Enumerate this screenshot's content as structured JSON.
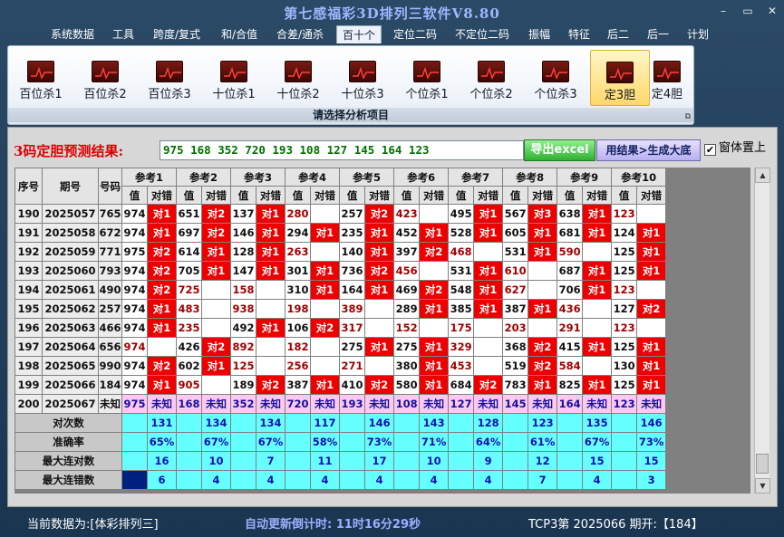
{
  "window": {
    "title": "第七感福彩3D排列三软件V8.80",
    "minimize": "–",
    "maximize": "▭",
    "close": "✕"
  },
  "menu": [
    "系统数据",
    "工具",
    "跨度/复式",
    "和/合值",
    "合差/通杀",
    "百十个",
    "定位二码",
    "不定位二码",
    "振幅",
    "特征",
    "后二",
    "后一",
    "计划"
  ],
  "menu_active": "百十个",
  "ribbon": {
    "buttons": [
      "百位杀1",
      "百位杀2",
      "百位杀3",
      "十位杀1",
      "十位杀2",
      "十位杀3",
      "个位杀1",
      "个位杀2",
      "个位杀3",
      "定3胆",
      "定4胆"
    ],
    "active": "定3胆",
    "caption": "请选择分析项目"
  },
  "prediction": {
    "label": "3码定胆预测结果:",
    "value": "975 168 352 720 193 108 127 145 164 123",
    "excel_button": "导出excel",
    "generate_button": "用结果>生成大底",
    "stay_on_top_label": "窗体置上",
    "stay_on_top_checked": true
  },
  "table": {
    "headers": {
      "index": "序号",
      "period": "期号",
      "number": "号码",
      "value": "值",
      "hit": "对错"
    },
    "refs": [
      "参考1",
      "参考2",
      "参考3",
      "参考4",
      "参考5",
      "参考6",
      "参考7",
      "参考8",
      "参考9",
      "参考10"
    ],
    "rows": [
      {
        "idx": "190",
        "period": "2025057",
        "num": "765",
        "cells": [
          [
            "974",
            "对1"
          ],
          [
            "651",
            "对2"
          ],
          [
            "137",
            "对1"
          ],
          [
            "280",
            ""
          ],
          [
            "257",
            "对2"
          ],
          [
            "423",
            ""
          ],
          [
            "495",
            "对1"
          ],
          [
            "567",
            "对3"
          ],
          [
            "638",
            "对1"
          ],
          [
            "123",
            ""
          ]
        ]
      },
      {
        "idx": "191",
        "period": "2025058",
        "num": "672",
        "cells": [
          [
            "974",
            "对1"
          ],
          [
            "697",
            "对2"
          ],
          [
            "146",
            "对1"
          ],
          [
            "294",
            "对1"
          ],
          [
            "235",
            "对1"
          ],
          [
            "452",
            "对1"
          ],
          [
            "528",
            "对1"
          ],
          [
            "605",
            "对1"
          ],
          [
            "681",
            "对1"
          ],
          [
            "124",
            "对1"
          ]
        ]
      },
      {
        "idx": "192",
        "period": "2025059",
        "num": "771",
        "cells": [
          [
            "975",
            "对2"
          ],
          [
            "614",
            "对1"
          ],
          [
            "128",
            "对1"
          ],
          [
            "263",
            ""
          ],
          [
            "140",
            "对1"
          ],
          [
            "397",
            "对2"
          ],
          [
            "468",
            ""
          ],
          [
            "531",
            "对1"
          ],
          [
            "590",
            ""
          ],
          [
            "125",
            "对1"
          ]
        ]
      },
      {
        "idx": "193",
        "period": "2025060",
        "num": "793",
        "cells": [
          [
            "974",
            "对2"
          ],
          [
            "705",
            "对1"
          ],
          [
            "147",
            "对1"
          ],
          [
            "301",
            "对1"
          ],
          [
            "736",
            "对2"
          ],
          [
            "456",
            ""
          ],
          [
            "531",
            "对1"
          ],
          [
            "610",
            ""
          ],
          [
            "687",
            "对1"
          ],
          [
            "125",
            "对1"
          ]
        ]
      },
      {
        "idx": "194",
        "period": "2025061",
        "num": "490",
        "cells": [
          [
            "974",
            "对2"
          ],
          [
            "725",
            ""
          ],
          [
            "158",
            ""
          ],
          [
            "310",
            "对1"
          ],
          [
            "164",
            "对1"
          ],
          [
            "469",
            "对2"
          ],
          [
            "548",
            "对1"
          ],
          [
            "627",
            ""
          ],
          [
            "706",
            "对1"
          ],
          [
            "123",
            ""
          ]
        ]
      },
      {
        "idx": "195",
        "period": "2025062",
        "num": "257",
        "cells": [
          [
            "974",
            "对1"
          ],
          [
            "483",
            ""
          ],
          [
            "938",
            ""
          ],
          [
            "198",
            ""
          ],
          [
            "389",
            ""
          ],
          [
            "289",
            "对1"
          ],
          [
            "385",
            "对1"
          ],
          [
            "387",
            "对1"
          ],
          [
            "436",
            ""
          ],
          [
            "127",
            "对2"
          ]
        ]
      },
      {
        "idx": "196",
        "period": "2025063",
        "num": "466",
        "cells": [
          [
            "974",
            "对1"
          ],
          [
            "235",
            ""
          ],
          [
            "492",
            "对1"
          ],
          [
            "106",
            "对2"
          ],
          [
            "317",
            ""
          ],
          [
            "152",
            ""
          ],
          [
            "175",
            ""
          ],
          [
            "203",
            ""
          ],
          [
            "291",
            ""
          ],
          [
            "123",
            ""
          ]
        ]
      },
      {
        "idx": "197",
        "period": "2025064",
        "num": "656",
        "cells": [
          [
            "974",
            ""
          ],
          [
            "426",
            "对2"
          ],
          [
            "892",
            ""
          ],
          [
            "182",
            ""
          ],
          [
            "275",
            "对1"
          ],
          [
            "275",
            "对1"
          ],
          [
            "329",
            ""
          ],
          [
            "368",
            "对2"
          ],
          [
            "415",
            "对1"
          ],
          [
            "125",
            "对1"
          ]
        ]
      },
      {
        "idx": "198",
        "period": "2025065",
        "num": "990",
        "cells": [
          [
            "974",
            "对2"
          ],
          [
            "602",
            "对1"
          ],
          [
            "125",
            ""
          ],
          [
            "256",
            ""
          ],
          [
            "271",
            ""
          ],
          [
            "380",
            "对1"
          ],
          [
            "453",
            ""
          ],
          [
            "519",
            "对2"
          ],
          [
            "584",
            ""
          ],
          [
            "130",
            "对1"
          ]
        ]
      },
      {
        "idx": "199",
        "period": "2025066",
        "num": "184",
        "cells": [
          [
            "974",
            "对1"
          ],
          [
            "905",
            ""
          ],
          [
            "189",
            "对2"
          ],
          [
            "387",
            "对1"
          ],
          [
            "410",
            "对2"
          ],
          [
            "580",
            "对1"
          ],
          [
            "684",
            "对2"
          ],
          [
            "783",
            "对1"
          ],
          [
            "825",
            "对1"
          ],
          [
            "125",
            "对1"
          ]
        ]
      }
    ],
    "last_row": {
      "idx": "200",
      "period": "2025067",
      "num": "未知",
      "cells": [
        [
          "975",
          "未知"
        ],
        [
          "168",
          "未知"
        ],
        [
          "352",
          "未知"
        ],
        [
          "720",
          "未知"
        ],
        [
          "193",
          "未知"
        ],
        [
          "108",
          "未知"
        ],
        [
          "127",
          "未知"
        ],
        [
          "145",
          "未知"
        ],
        [
          "164",
          "未知"
        ],
        [
          "123",
          "未知"
        ]
      ]
    },
    "stats": [
      {
        "label": "对次数",
        "values": [
          "131",
          "134",
          "134",
          "117",
          "146",
          "143",
          "128",
          "123",
          "135",
          "146"
        ]
      },
      {
        "label": "准确率",
        "values": [
          "65%",
          "67%",
          "67%",
          "58%",
          "73%",
          "71%",
          "64%",
          "61%",
          "67%",
          "73%"
        ]
      },
      {
        "label": "最大连对数",
        "values": [
          "16",
          "10",
          "7",
          "11",
          "17",
          "10",
          "9",
          "12",
          "15",
          "15"
        ]
      },
      {
        "label": "最大连错数",
        "values": [
          "6",
          "4",
          "4",
          "4",
          "4",
          "4",
          "4",
          "7",
          "4",
          "3"
        ]
      }
    ]
  },
  "status": {
    "current_data": "当前数据为:[体彩排列三]",
    "countdown": "自动更新倒计时:  11时16分29秒",
    "period_info": "TCP3第 2025066 期开:【184】"
  },
  "colors": {
    "hit": "#ee0000",
    "miss_text": "#a00000",
    "stats_bg": "#66ffff",
    "last_row_bg": "#ffc8f0",
    "pred_text": "#007000"
  }
}
